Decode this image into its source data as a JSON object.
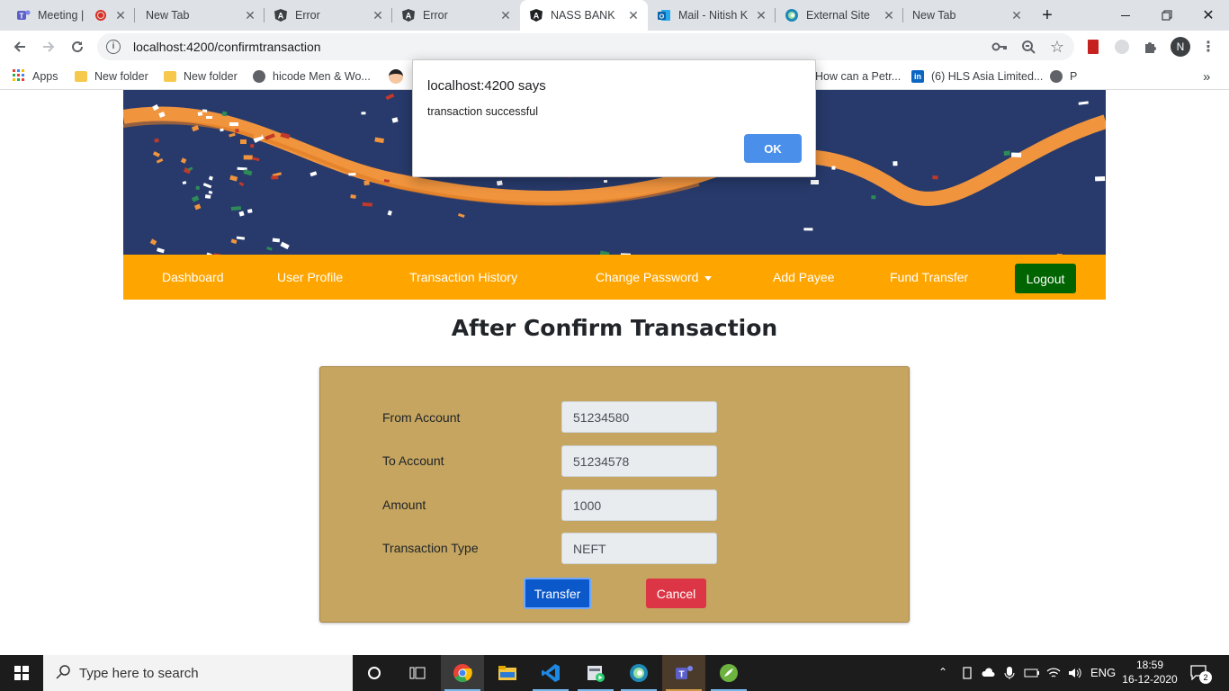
{
  "browser": {
    "tabs": [
      {
        "title": "Meeting |",
        "icon": "teams-icon"
      },
      {
        "title": "New Tab",
        "icon": ""
      },
      {
        "title": "Error",
        "icon": "angular-icon"
      },
      {
        "title": "Error",
        "icon": "angular-icon"
      },
      {
        "title": "NASS BANK",
        "icon": "angular-icon"
      },
      {
        "title": "Mail - Nitish K",
        "icon": "outlook-icon"
      },
      {
        "title": "External Site",
        "icon": "edge-icon"
      },
      {
        "title": "New Tab",
        "icon": ""
      }
    ],
    "active_tab": 4,
    "url": "localhost:4200/confirmtransaction",
    "profile_initial": "N",
    "bookmarks": [
      {
        "label": "Apps",
        "icon": "apps-grid-icon"
      },
      {
        "label": "New folder",
        "icon": "folder-icon"
      },
      {
        "label": "New folder",
        "icon": "folder-icon"
      },
      {
        "label": "hicode Men & Wo...",
        "icon": "globe-icon"
      },
      {
        "label": "How can a Petr...",
        "icon": "page-icon"
      },
      {
        "label": "(6) HLS Asia Limited...",
        "icon": "linkedin-icon"
      },
      {
        "label": "P",
        "icon": "globe-icon"
      }
    ],
    "more_bookmarks": "»"
  },
  "dialog": {
    "title": "localhost:4200 says",
    "message": "transaction successful",
    "ok_label": "OK"
  },
  "nav": {
    "items": [
      "Dashboard",
      "User Profile",
      "Transaction History",
      "Change Password",
      "Add Payee",
      "Fund Transfer"
    ],
    "logout_label": "Logout",
    "accent": "#ffa500",
    "logout_color": "#006400"
  },
  "page": {
    "title": "After Confirm Transaction"
  },
  "form": {
    "fields": [
      {
        "label": "From Account",
        "value": "51234580"
      },
      {
        "label": "To Account",
        "value": "51234578"
      },
      {
        "label": "Amount",
        "value": "1000"
      },
      {
        "label": "Transaction Type",
        "value": "NEFT"
      }
    ],
    "transfer_label": "Transfer",
    "cancel_label": "Cancel",
    "card_color": "#c5a55f"
  },
  "taskbar": {
    "search_placeholder": "Type here to search",
    "language": "ENG",
    "time": "18:59",
    "date": "16-12-2020",
    "notifications": "2"
  }
}
